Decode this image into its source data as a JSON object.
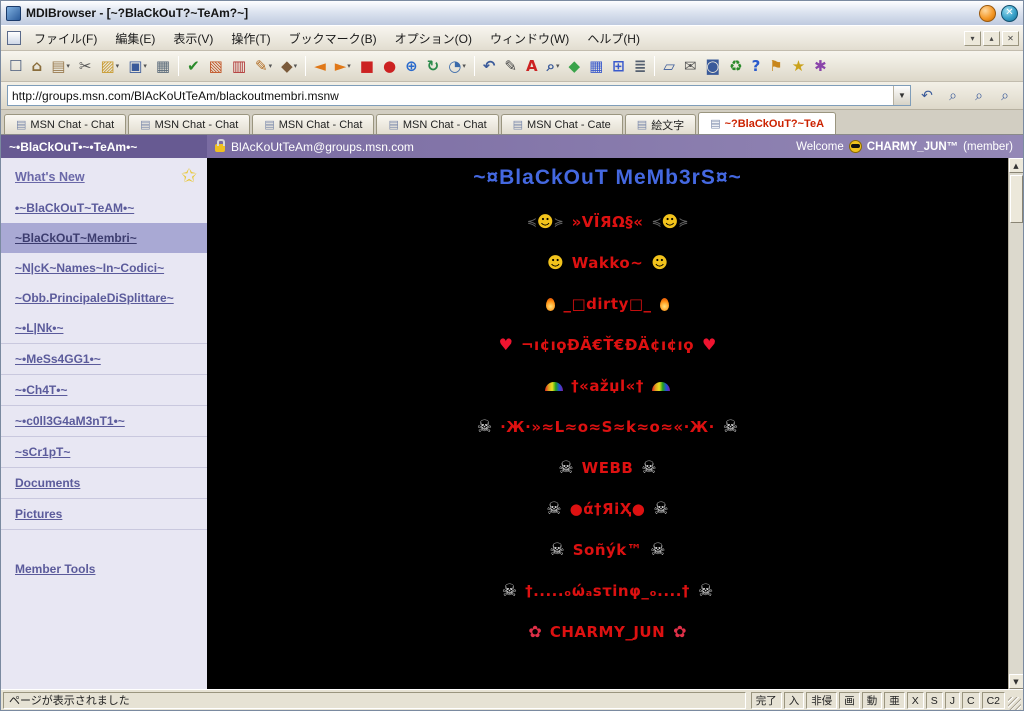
{
  "window": {
    "title": "MDIBrowser - [~?BlaCkOuT?~TeAm?~]"
  },
  "menubar": {
    "items": [
      "ファイル(F)",
      "編集(E)",
      "表示(V)",
      "操作(T)",
      "ブックマーク(B)",
      "オプション(O)",
      "ウィンドウ(W)",
      "ヘルプ(H)"
    ],
    "window_buttons": [
      {
        "name": "child-minimize-icon",
        "glyph": "▾"
      },
      {
        "name": "child-restore-icon",
        "glyph": "▴"
      },
      {
        "name": "child-close-icon",
        "glyph": "✕"
      }
    ]
  },
  "toolbar": {
    "icons": [
      {
        "name": "new-page-icon",
        "glyph": "☐",
        "color": "#47597a"
      },
      {
        "name": "home-icon",
        "glyph": "⌂",
        "color": "#8a6d3b"
      },
      {
        "name": "clipboard-paste-icon",
        "glyph": "▤",
        "color": "#9a7b4f",
        "split": true
      },
      {
        "name": "cut-icon",
        "glyph": "✂",
        "color": "#555555"
      },
      {
        "name": "folder-open-icon",
        "glyph": "▨",
        "color": "#c8992c",
        "split": true
      },
      {
        "name": "save-icon",
        "glyph": "▣",
        "color": "#3a5a9a",
        "split": true
      },
      {
        "name": "print-icon",
        "glyph": "▦",
        "color": "#5a6a7a"
      },
      {
        "sep": true
      },
      {
        "name": "check-icon",
        "glyph": "✔",
        "color": "#2a8a2a"
      },
      {
        "name": "photo-icon",
        "glyph": "▧",
        "color": "#c05020"
      },
      {
        "name": "document-red-icon",
        "glyph": "▥",
        "color": "#b03030"
      },
      {
        "name": "pencil-icon",
        "glyph": "✎",
        "color": "#b06a20",
        "split": true
      },
      {
        "name": "marker-icon",
        "glyph": "◆",
        "color": "#7a5a3a",
        "split": true
      },
      {
        "sep": true
      },
      {
        "name": "back-icon",
        "glyph": "◄",
        "color": "#e07818"
      },
      {
        "name": "forward-icon",
        "glyph": "►",
        "color": "#e07818",
        "split": true
      },
      {
        "name": "stop-icon",
        "glyph": "■",
        "color": "#cc2222"
      },
      {
        "name": "record-icon",
        "glyph": "●",
        "color": "#cc2222"
      },
      {
        "name": "globe-icon",
        "glyph": "⊕",
        "color": "#2a6acc"
      },
      {
        "name": "refresh-icon",
        "glyph": "↻",
        "color": "#2a8a4a"
      },
      {
        "name": "clock-icon",
        "glyph": "◔",
        "color": "#3a6aaa",
        "split": true
      },
      {
        "sep": true
      },
      {
        "name": "undo-icon",
        "glyph": "↶",
        "color": "#3a5a9a"
      },
      {
        "name": "edit-icon",
        "glyph": "✎",
        "color": "#444444"
      },
      {
        "name": "font-color-icon",
        "glyph": "A",
        "color": "#cc2222"
      },
      {
        "name": "search-icon",
        "glyph": "⌕",
        "color": "#3a5a9a",
        "split": true
      },
      {
        "name": "puzzle-icon",
        "glyph": "◆",
        "color": "#3aa34a"
      },
      {
        "name": "table-icon",
        "glyph": "▦",
        "color": "#3a5acc"
      },
      {
        "name": "cells-icon",
        "glyph": "⊞",
        "color": "#3a5acc"
      },
      {
        "name": "list-icon",
        "glyph": "≣",
        "color": "#556070"
      },
      {
        "sep": true
      },
      {
        "name": "window-new-icon",
        "glyph": "▱",
        "color": "#3a5a9a"
      },
      {
        "name": "mail-icon",
        "glyph": "✉",
        "color": "#555555"
      },
      {
        "name": "disk-icon",
        "glyph": "◙",
        "color": "#3a5a9a"
      },
      {
        "name": "recycle-icon",
        "glyph": "♻",
        "color": "#2a8a2a"
      },
      {
        "name": "help-icon",
        "glyph": "?",
        "color": "#2a5acc"
      },
      {
        "name": "flag-icon",
        "glyph": "⚑",
        "color": "#c8861c"
      },
      {
        "name": "star-icon",
        "glyph": "★",
        "color": "#caa21c"
      },
      {
        "name": "tools-icon",
        "glyph": "✱",
        "color": "#8a44aa"
      }
    ]
  },
  "addressbar": {
    "url": "http://groups.msn.com/BlAcKoUtTeAm/blackoutmembri.msnw",
    "buttons": [
      {
        "name": "history-back-icon",
        "glyph": "↶"
      },
      {
        "name": "search-zoom-1-icon",
        "glyph": "⌕"
      },
      {
        "name": "search-zoom-2-icon",
        "glyph": "⌕"
      },
      {
        "name": "search-zoom-3-icon",
        "glyph": "⌕"
      }
    ]
  },
  "tabs": [
    {
      "label": "MSN Chat - Chat",
      "active": false
    },
    {
      "label": "MSN Chat - Chat",
      "active": false
    },
    {
      "label": "MSN Chat - Chat",
      "active": false
    },
    {
      "label": "MSN Chat - Chat",
      "active": false
    },
    {
      "label": "MSN Chat - Cate",
      "active": false
    },
    {
      "label": "絵文字",
      "active": false
    },
    {
      "label": "~?BlaCkOuT?~TeA",
      "active": true
    }
  ],
  "group_header": {
    "team_name": "~•BlaCkOuT•~•TeAm•~",
    "email": "BlAcKoUtTeAm@groups.msn.com",
    "welcome_prefix": "Welcome",
    "username": "CHARMY_JUN™",
    "member_suffix": "(member)"
  },
  "sidebar": {
    "whats_new": "What's New",
    "items": [
      {
        "label": "•~BlaCkOuT~TeAM•~",
        "selected": false,
        "divider": false
      },
      {
        "label": "~BlaCkOuT~Membri~",
        "selected": true,
        "divider": false
      },
      {
        "label": "~N|cK~Names~In~Codici~",
        "selected": false,
        "divider": false
      },
      {
        "label": "~Obb.PrincipaleDiSplittare~",
        "selected": false,
        "divider": false
      },
      {
        "label": "~•L|Nk•~",
        "selected": false,
        "divider": true
      },
      {
        "label": "~•MeSs4GG1•~",
        "selected": false,
        "divider": true
      },
      {
        "label": "~•Ch4T•~",
        "selected": false,
        "divider": true
      },
      {
        "label": "~•c0ll3G4aM3nT1•~",
        "selected": false,
        "divider": true
      },
      {
        "label": "~sCr1pT~",
        "selected": false,
        "divider": true
      },
      {
        "label": "Documents",
        "selected": false,
        "divider": true
      },
      {
        "label": "Pictures",
        "selected": false,
        "divider": true
      }
    ],
    "member_tools": "Member Tools"
  },
  "content": {
    "title": "~¤BlaCkOuT MeMb3rS¤~",
    "members": [
      {
        "icon": "devil-smiley-icon",
        "name": "»VÏЯΩ§«"
      },
      {
        "icon": "smiley-icon",
        "name": "Wakko~"
      },
      {
        "icon": "flame-icon",
        "name": "_□dirty□_"
      },
      {
        "icon": "heart-icon",
        "name": "¬ı¢ıϙÐÄ€Ť€ÐÄ¢ı¢ıϙ"
      },
      {
        "icon": "rainbow-icon",
        "name": "†«ažџl«†"
      },
      {
        "icon": "skull-icon",
        "name": "·Ж·»≈L≈o≈S≈k≈o≈«·Ж·"
      },
      {
        "icon": "skull-icon",
        "name": "WEBB"
      },
      {
        "icon": "skull-icon",
        "name": "●ά†ЯiҲ●"
      },
      {
        "icon": "skull-icon",
        "name": "Soñýk™"
      },
      {
        "icon": "skull-icon",
        "name": "†.....ₒώₐsτinφ_ₒ....†"
      },
      {
        "icon": "rose-icon",
        "name": "CHARMY_JUN"
      }
    ]
  },
  "statusbar": {
    "message": "ページが表示されました",
    "indicators": [
      "完了",
      "入",
      "非侵",
      "画",
      "動",
      "亜",
      "X",
      "S",
      "J",
      "C",
      "C2"
    ]
  }
}
